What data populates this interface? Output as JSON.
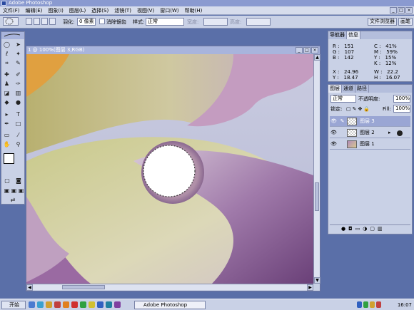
{
  "app": {
    "title": "Adobe Photoshop",
    "accent": "#8a9ad0",
    "panel_bg": "#c9d1e6"
  },
  "menu": [
    "文件(F)",
    "编辑(E)",
    "图象(I)",
    "图层(L)",
    "选择(S)",
    "滤镜(T)",
    "视图(V)",
    "窗口(W)",
    "帮助(H)"
  ],
  "window_controls": [
    "_",
    "□",
    "×"
  ],
  "options": {
    "feather_label": "羽化:",
    "feather_value": "0 像素",
    "antialias_label": "消除锯齿",
    "style_label": "样式:",
    "style_value": "正常",
    "width_label": "宽度:",
    "height_label": "高度:"
  },
  "palette_tabs": [
    "文件浏览器",
    "画笔"
  ],
  "document": {
    "title": "1 @ 100%(图层 3,RGB)",
    "controls": [
      "_",
      "□",
      "×"
    ]
  },
  "info_panel": {
    "tabs": [
      "导航器",
      "信息"
    ],
    "rgb": "R :   151\nG :   107\nB :   142",
    "cmyk": "C :   41%\nM :   59%\nY :   15%\nK :   12%",
    "xy": "X :   24.96\nY :   18.47",
    "wh": "W :   22.2\nH :   16.07"
  },
  "layers_panel": {
    "tabs": [
      "图层",
      "通道",
      "路径"
    ],
    "blend_mode": "正常",
    "opacity_label": "不透明度:",
    "opacity_value": "100%",
    "lock_label": "锁定:",
    "fill_label": "Fill:",
    "fill_value": "100%",
    "layers": [
      {
        "name": "图层 3",
        "selected": true
      },
      {
        "name": "图层 2",
        "selected": false
      },
      {
        "name": "图层 1",
        "selected": false
      }
    ],
    "fx_label": "ⓘ"
  },
  "taskbar": {
    "start": "开始",
    "item": "Adobe Photoshop",
    "clock": "16:07"
  }
}
